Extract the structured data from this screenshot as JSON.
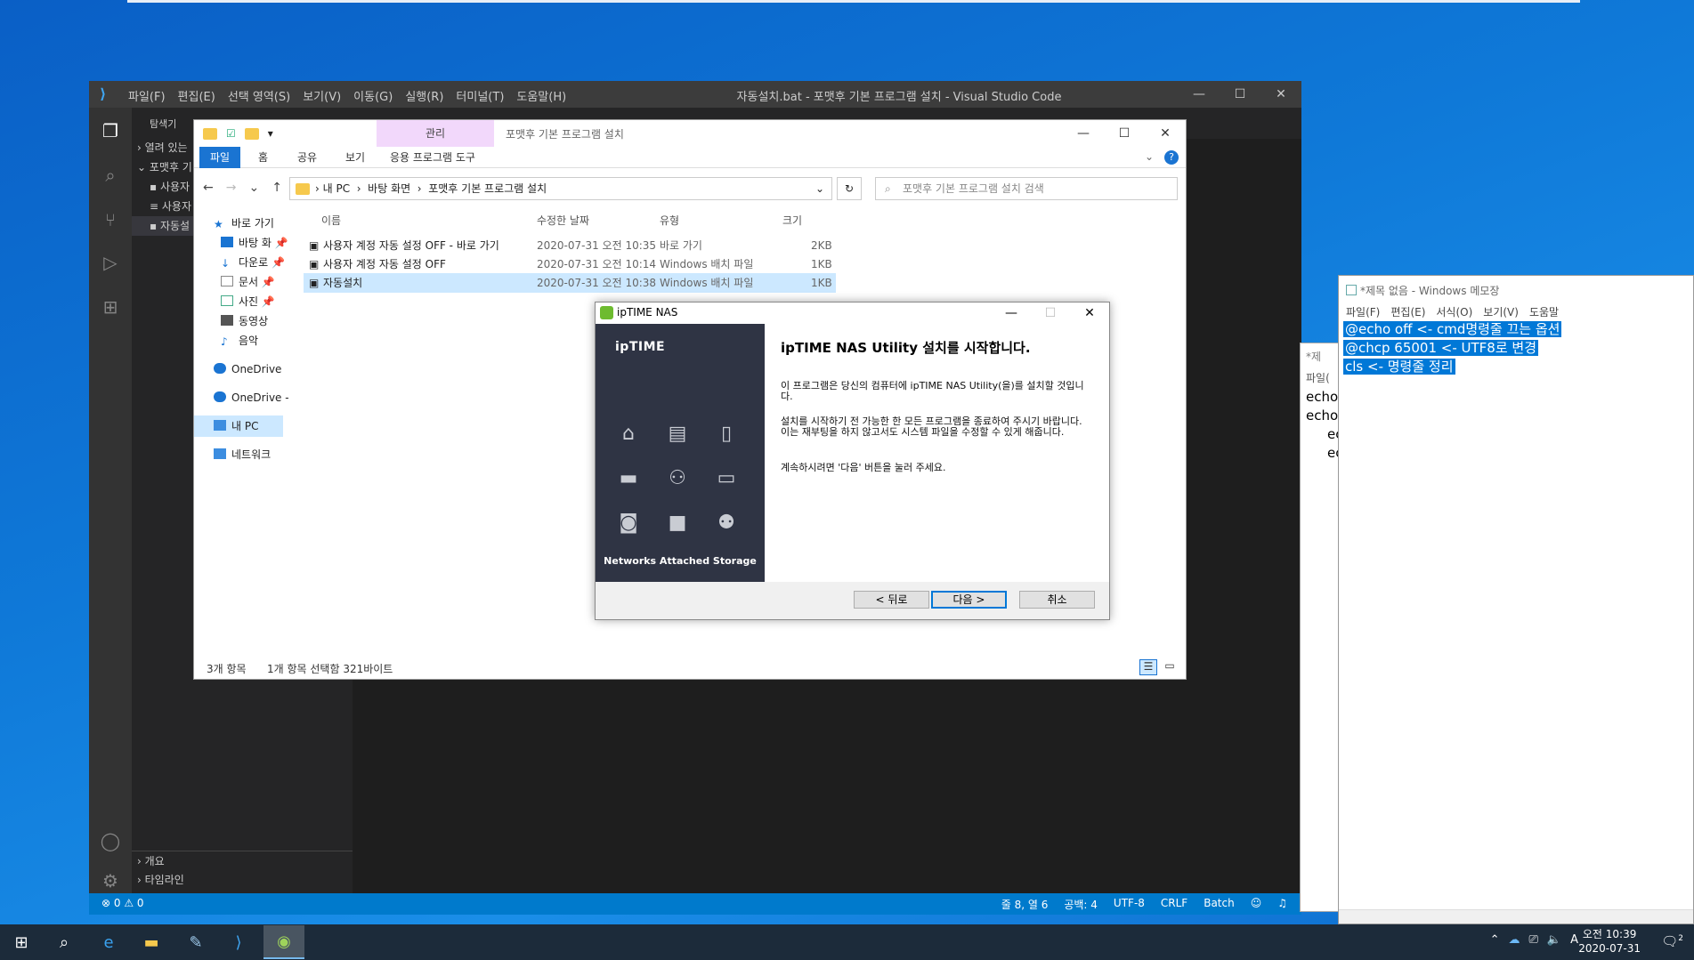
{
  "vscode": {
    "window_title": "자동설치.bat - 포맷후 기본 프로그램 설치 - Visual Studio Code",
    "menu": [
      "파일(F)",
      "편집(E)",
      "선택 영역(S)",
      "보기(V)",
      "이동(G)",
      "실행(R)",
      "터미널(T)",
      "도움말(H)"
    ],
    "sidebar": {
      "header": "탐색기",
      "open_editors": "열려 있는",
      "folder": "포맷후 기",
      "items": [
        "사용자",
        "사용자",
        "자동설"
      ],
      "outline": "개요",
      "timeline": "타임라인"
    },
    "status": {
      "errors": "0",
      "warnings": "0",
      "position": "줄 8, 열 6",
      "spaces": "공백: 4",
      "encoding": "UTF-8",
      "eol": "CRLF",
      "language": "Batch"
    }
  },
  "explorer": {
    "window_title": "포맷후 기본 프로그램 설치",
    "manage_tab": "관리",
    "ribbon_tabs": [
      "파일",
      "홈",
      "공유",
      "보기",
      "응용 프로그램 도구"
    ],
    "breadcrumb": [
      "내 PC",
      "바탕 화면",
      "포맷후 기본 프로그램 설치"
    ],
    "search_placeholder": "포맷후 기본 프로그램 설치 검색",
    "nav": [
      "바로 가기",
      "바탕 화",
      "다운로",
      "문서",
      "사진",
      "동영상",
      "음악",
      "OneDrive",
      "OneDrive -",
      "내 PC",
      "네트워크"
    ],
    "columns": [
      "이름",
      "수정한 날짜",
      "유형",
      "크기"
    ],
    "files": [
      {
        "name": "사용자 계정 자동 설정 OFF - 바로 가기",
        "date": "2020-07-31 오전 10:35",
        "type": "바로 가기",
        "size": "2KB"
      },
      {
        "name": "사용자 계정 자동 설정 OFF",
        "date": "2020-07-31 오전 10:14",
        "type": "Windows 배치 파일",
        "size": "1KB"
      },
      {
        "name": "자동설치",
        "date": "2020-07-31 오전 10:38",
        "type": "Windows 배치 파일",
        "size": "1KB"
      }
    ],
    "status_count": "3개 항목",
    "status_selected": "1개 항목 선택함 321바이트"
  },
  "installer": {
    "title": "ipTIME NAS",
    "brand": "ipTIME",
    "heading": "ipTIME NAS Utility 설치를 시작합니다.",
    "p1": "이 프로그램은 당신의 컴퓨터에 ipTIME NAS Utility(을)를 설치할 것입니다.",
    "p2": "설치를 시작하기 전 가능한 한 모든 프로그램을 종료하여 주시기 바랍니다. 이는 재부팅을 하지 않고서도 시스템 파일을 수정할 수 있게 해줍니다.",
    "p3": "계속하시려면 '다음' 버튼을 눌러 주세요.",
    "nas_label": "Networks Attached Storage",
    "back": "< 뒤로",
    "next": "다음 >",
    "cancel": "취소"
  },
  "notepad": {
    "title": "*제목 없음 - Windows 메모장",
    "menu": [
      "파일(F)",
      "편집(E)",
      "서식(O)",
      "보기(V)",
      "도움말"
    ],
    "lines": [
      "@echo off <- cmd명령줄 끄는 옵션",
      "@chcp 65001 <- UTF8로 변경",
      "cls <- 명령줄 정리"
    ]
  },
  "notepad_back": {
    "title": "*제",
    "menu": "파일(",
    "lines": [
      "echo.",
      "echo",
      "ec",
      "ec"
    ]
  },
  "taskbar": {
    "time": "오전 10:39",
    "date": "2020-07-31",
    "ime": "A",
    "notifications": "2"
  }
}
